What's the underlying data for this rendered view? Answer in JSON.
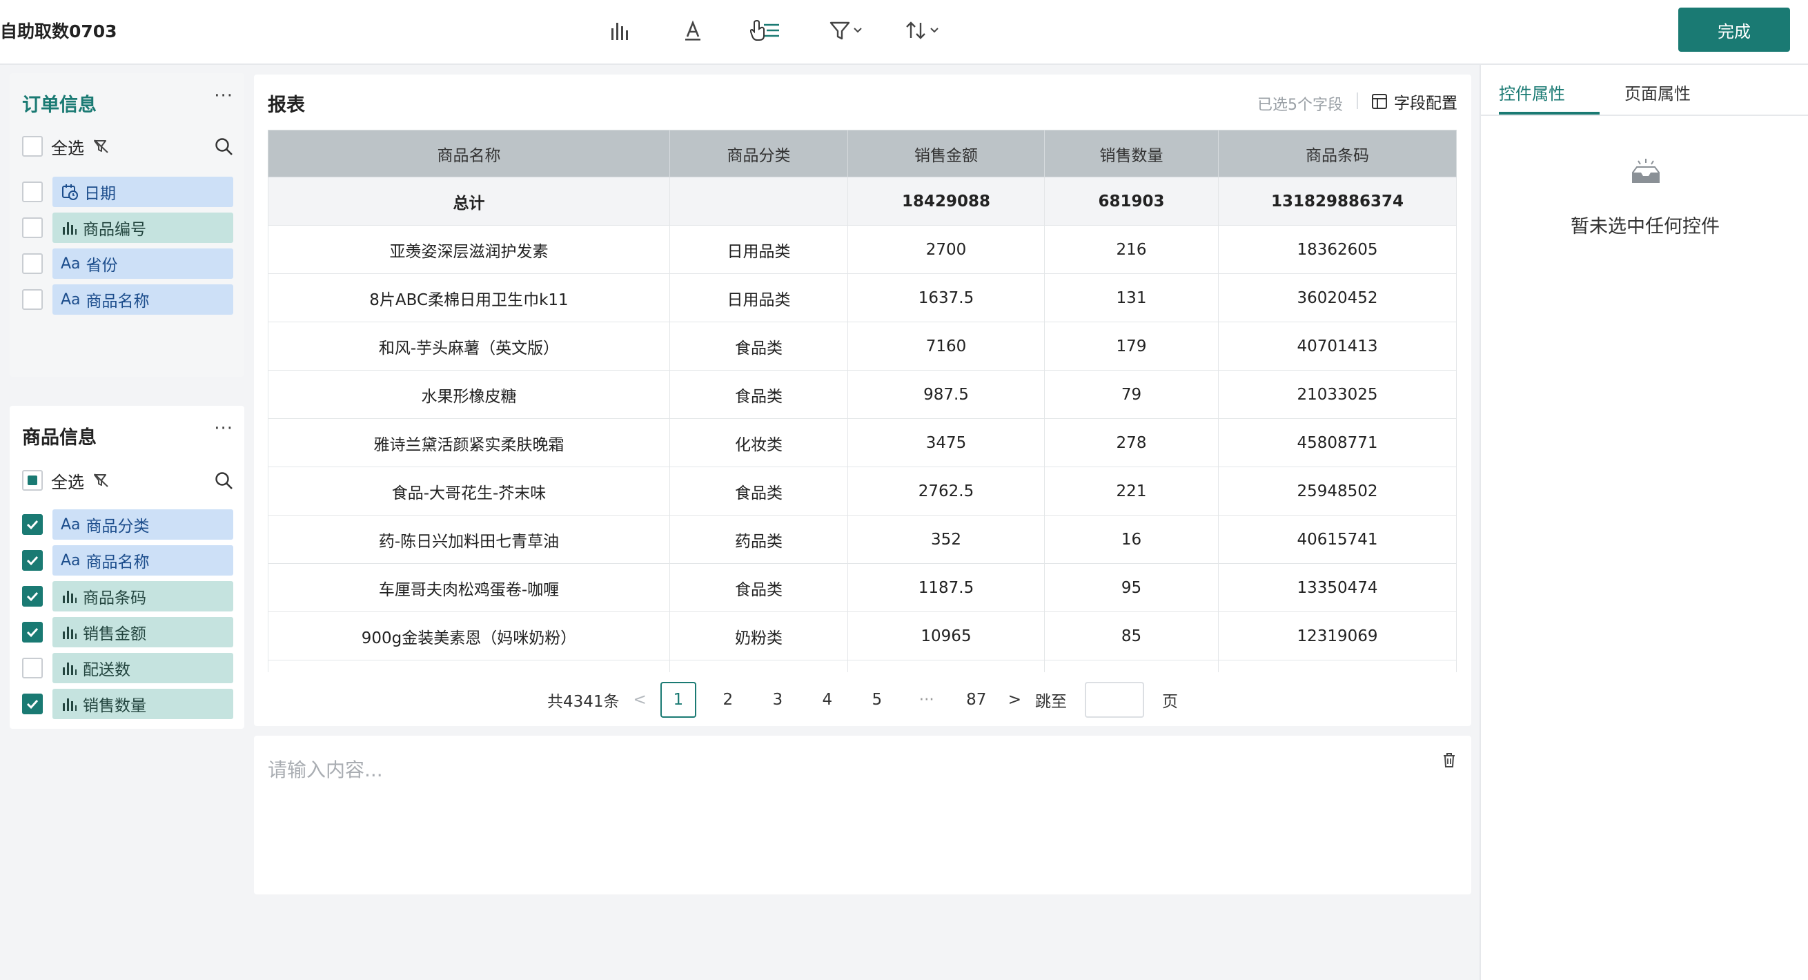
{
  "header": {
    "title": "自助取数0703",
    "done_label": "完成"
  },
  "order_panel": {
    "title": "订单信息",
    "more": "···",
    "select_all": "全选",
    "fields": [
      {
        "type": "date",
        "label": "日期",
        "checked": false,
        "color": "blue"
      },
      {
        "type": "number",
        "label": "商品编号",
        "checked": false,
        "color": "teal"
      },
      {
        "type": "text",
        "label": "省份",
        "checked": false,
        "color": "blue"
      },
      {
        "type": "text",
        "label": "商品名称",
        "checked": false,
        "color": "blue"
      }
    ]
  },
  "product_panel": {
    "title": "商品信息",
    "more": "···",
    "select_all": "全选",
    "fields": [
      {
        "type": "text",
        "label": "商品分类",
        "checked": true,
        "color": "blue"
      },
      {
        "type": "text",
        "label": "商品名称",
        "checked": true,
        "color": "blue"
      },
      {
        "type": "number",
        "label": "商品条码",
        "checked": true,
        "color": "teal"
      },
      {
        "type": "number",
        "label": "销售金额",
        "checked": true,
        "color": "teal"
      },
      {
        "type": "number",
        "label": "配送数",
        "checked": false,
        "color": "teal"
      },
      {
        "type": "number",
        "label": "销售数量",
        "checked": true,
        "color": "teal"
      }
    ]
  },
  "report": {
    "title": "报表",
    "selected_count": "已选5个字段",
    "field_config": "字段配置",
    "columns": [
      "商品名称",
      "商品分类",
      "销售金额",
      "销售数量",
      "商品条码"
    ],
    "total_row": [
      "总计",
      "",
      "18429088",
      "681903",
      "131829886374"
    ],
    "rows": [
      [
        "亚羡姿深层滋润护发素",
        "日用品类",
        "2700",
        "216",
        "18362605"
      ],
      [
        "8片ABC柔棉日用卫生巾k11",
        "日用品类",
        "1637.5",
        "131",
        "36020452"
      ],
      [
        "和风-芋头麻薯（英文版）",
        "食品类",
        "7160",
        "179",
        "40701413"
      ],
      [
        "水果形橡皮糖",
        "食品类",
        "987.5",
        "79",
        "21033025"
      ],
      [
        "雅诗兰黛活颜紧实柔肤晚霜",
        "化妆类",
        "3475",
        "278",
        "45808771"
      ],
      [
        "食品-大哥花生-芥末味",
        "食品类",
        "2762.5",
        "221",
        "25948502"
      ],
      [
        "药-陈日兴加料田七青草油",
        "药品类",
        "352",
        "16",
        "40615741"
      ],
      [
        "车厘哥夫肉松鸡蛋卷-咖喱",
        "食品类",
        "1187.5",
        "95",
        "13350474"
      ],
      [
        "900g金装美素恩（妈咪奶粉）",
        "奶粉类",
        "10965",
        "85",
        "12319069"
      ]
    ]
  },
  "pagination": {
    "total": "共4341条",
    "prev": "<",
    "pages": [
      "1",
      "2",
      "3",
      "4",
      "5"
    ],
    "ellipsis": "···",
    "last": "87",
    "next": ">",
    "jump_label": "跳至",
    "page_unit": "页"
  },
  "text_box": {
    "placeholder": "请输入内容..."
  },
  "right_panel": {
    "tabs": [
      "控件属性",
      "页面属性"
    ],
    "empty_text": "暂未选中任何控件"
  },
  "colors": {
    "accent": "#1a7a73",
    "chip_blue": "#cde0f7",
    "chip_teal": "#c5e3df",
    "table_header": "#bcc3c7"
  }
}
